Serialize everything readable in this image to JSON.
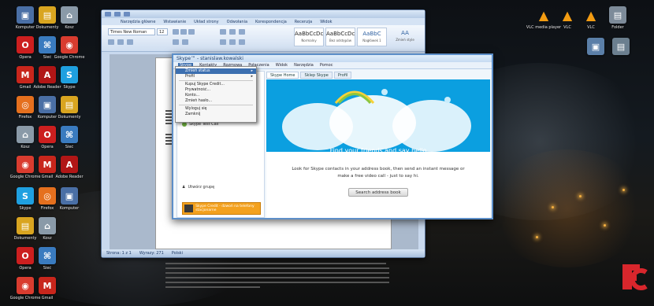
{
  "desktop_icons": [
    {
      "label": "Komputer",
      "color": "#4a6fa5",
      "glyph": "▣",
      "icon": "computer-icon"
    },
    {
      "label": "Dokumenty",
      "color": "#d9a520",
      "glyph": "▤",
      "icon": "folder-icon"
    },
    {
      "label": "Kosz",
      "color": "#8a9aa8",
      "glyph": "⌂",
      "icon": "recycle-bin-icon"
    },
    {
      "label": "Opera",
      "color": "#cc1f1f",
      "glyph": "O",
      "icon": "opera-icon"
    },
    {
      "label": "Sieć",
      "color": "#3a7bbf",
      "glyph": "⌘",
      "icon": "network-icon"
    },
    {
      "label": "Google Chrome",
      "color": "#d93c2f",
      "glyph": "◉",
      "icon": "chrome-icon"
    },
    {
      "label": "Gmail",
      "color": "#c8261c",
      "glyph": "M",
      "icon": "gmail-icon"
    },
    {
      "label": "Adobe Reader",
      "color": "#b11616",
      "glyph": "A",
      "icon": "adobe-reader-icon"
    },
    {
      "label": "Skype",
      "color": "#1fa0e0",
      "glyph": "S",
      "icon": "skype-icon"
    },
    {
      "label": "Firefox",
      "color": "#e5701e",
      "glyph": "◎",
      "icon": "firefox-icon"
    }
  ],
  "right_icons": [
    {
      "label": "VLC media player",
      "icon": "vlc-icon"
    },
    {
      "label": "VLC",
      "icon": "vlc-icon"
    },
    {
      "label": "VLC",
      "icon": "vlc-icon"
    },
    {
      "label": "Folder",
      "icon": "folder-icon"
    }
  ],
  "word": {
    "tabs": [
      "Narzędzia główne",
      "Wstawianie",
      "Układ strony",
      "Odwołania",
      "Korespondencja",
      "Recenzja",
      "Widok"
    ],
    "font_name": "Times New Roman",
    "font_size": "12",
    "styles": [
      {
        "sample": "AaBbCcDc",
        "name": "Normalny"
      },
      {
        "sample": "AaBbCcDc",
        "name": "Bez odstępów"
      },
      {
        "sample": "AaBbC",
        "name": "Nagłówek 1"
      },
      {
        "sample": "AA",
        "name": "Zmień style"
      }
    ],
    "status_page": "Strona: 1 z 1",
    "status_words": "Wyrazy: 271",
    "status_lang": "Polski"
  },
  "skype": {
    "title": "Skype™ - stanislaw.kowalski",
    "menu": [
      "Skype",
      "Kontakty",
      "Rozmowa",
      "Połączenia",
      "Widok",
      "Narzędzia",
      "Pomoc"
    ],
    "open_menu_index": 0,
    "dropdown": [
      {
        "label": "Zmień status",
        "arrow": true
      },
      {
        "label": "Profil",
        "arrow": true
      },
      {
        "sep": true
      },
      {
        "label": "Kupuj Skype Credit..."
      },
      {
        "label": "Prywatność..."
      },
      {
        "label": "Konto..."
      },
      {
        "label": "Zmień hasło..."
      },
      {
        "sep": true
      },
      {
        "label": "Wyloguj się"
      },
      {
        "label": "Zamknij"
      }
    ],
    "tabs": [
      "Skype Home",
      "Sklep Skype",
      "Profil"
    ],
    "contact": "Skype Test Call",
    "create_group": "Utwórz grupę",
    "promo_text": "Skype Credit - dzwoń na telefony stacjonarne",
    "headline": "Find your friends and say hello",
    "body": "Look for Skype contacts in your address book, then send an instant message or make a free video call - just to say hi.",
    "search_button": "Search address book"
  }
}
